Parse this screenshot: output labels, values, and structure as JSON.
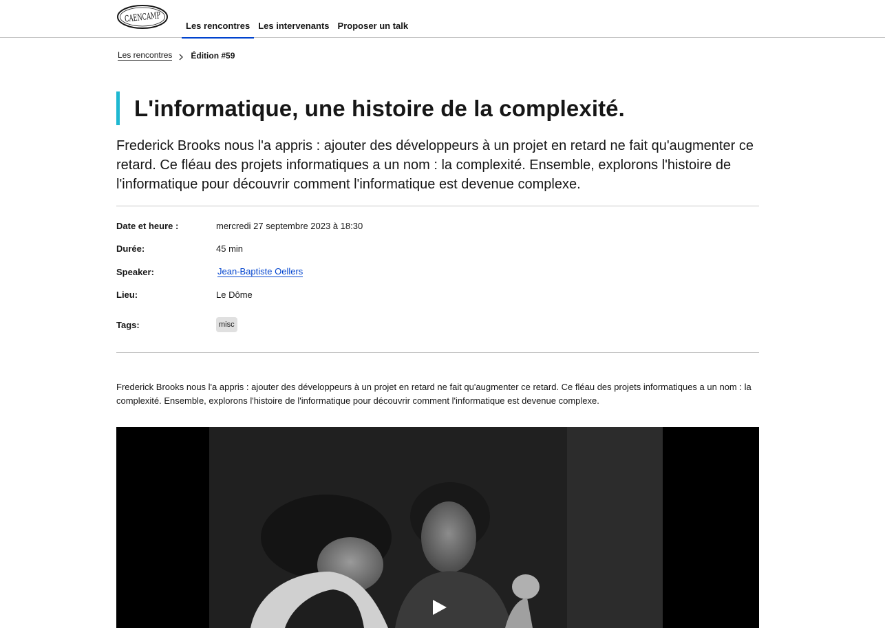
{
  "header": {
    "logo_text": "CAENCAMP",
    "nav": [
      {
        "label": "Les rencontres",
        "active": true
      },
      {
        "label": "Les intervenants",
        "active": false
      },
      {
        "label": "Proposer un talk",
        "active": false
      }
    ]
  },
  "breadcrumb": {
    "parent": "Les rencontres",
    "current": "Édition #59"
  },
  "event": {
    "title": "L'informatique, une histoire de la complexité.",
    "lead": "Frederick Brooks nous l'a appris : ajouter des développeurs à un projet en retard ne fait qu'augmenter ce retard. Ce fléau des projets informatiques a un nom : la complexité. Ensemble, explorons l'histoire de l'informatique pour découvrir comment l'informatique est devenue complexe.",
    "details": {
      "date_label": "Date et heure :",
      "date_value": "mercredi 27 septembre 2023 à 18:30",
      "duration_label": "Durée:",
      "duration_value": "45 min",
      "speaker_label": "Speaker:",
      "speaker_value": "Jean-Baptiste Oellers",
      "place_label": "Lieu:",
      "place_value": "Le Dôme",
      "tags_label": "Tags:",
      "tags": [
        "misc"
      ]
    },
    "description": "Frederick Brooks nous l'a appris : ajouter des développeurs à un projet en retard ne fait qu'augmenter ce retard. Ce fléau des projets informatiques a un nom : la complexité. Ensemble, explorons l'histoire de l'informatique pour découvrir comment l'informatique est devenue complexe."
  },
  "video": {
    "play_icon": "play-icon"
  },
  "colors": {
    "accent_bar": "#1eb8d1",
    "link": "#0043ce",
    "tag_bg": "#e0e0e0"
  }
}
